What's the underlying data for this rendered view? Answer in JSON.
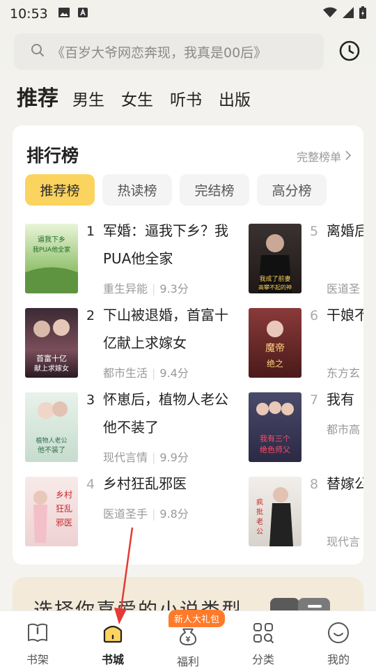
{
  "status_bar": {
    "time": "10:53"
  },
  "search": {
    "placeholder": "《百岁大爷网恋奔现，我真是00后》"
  },
  "channels": [
    "推荐",
    "男生",
    "女生",
    "听书",
    "出版"
  ],
  "ranking": {
    "title": "排行榜",
    "full_list_label": "完整榜单",
    "tabs": [
      "推荐榜",
      "热读榜",
      "完结榜",
      "高分榜"
    ],
    "active_tab": 0,
    "books_left": [
      {
        "rank": "1",
        "title": "军婚：逼我下乡？我PUA他全家",
        "category": "重生异能",
        "score": "9.3分",
        "cover_text": "逼我下乡 我PUA他全家",
        "cover_color": "#7fb35a"
      },
      {
        "rank": "2",
        "title": "下山被退婚，首富十亿献上求嫁女",
        "category": "都市生活",
        "score": "9.4分",
        "cover_text": "首富十亿 献上求嫁女",
        "cover_color": "#5a3a42"
      },
      {
        "rank": "3",
        "title": "怀崽后，植物人老公他不装了",
        "category": "现代言情",
        "score": "9.9分",
        "cover_text": "植物人老公 他不装了",
        "cover_color": "#cfe3d6"
      },
      {
        "rank": "4",
        "title": "乡村狂乱邪医",
        "category": "医道圣手",
        "score": "9.8分",
        "cover_text": "乡村狂乱邪医",
        "cover_color": "#f0d8d8"
      }
    ],
    "books_right": [
      {
        "rank": "5",
        "title": "离婚后妻高攀",
        "category": "医道圣",
        "cover_text": "我成了前妻 高攀不起的神",
        "cover_color": "#2a2220"
      },
      {
        "rank": "6",
        "title": "干娘不知",
        "category": "东方玄",
        "cover_text": "魔帝 绝之",
        "cover_color": "#6a2a2a"
      },
      {
        "rank": "7",
        "title": "我有",
        "category": "都市高",
        "cover_text": "我有三个 绝色师父",
        "cover_color": "#3a3a5a"
      },
      {
        "rank": "8",
        "title": "替嫁公请",
        "category": "现代言",
        "cover_text": "疯批老公 请挂号",
        "cover_color": "#e8e4e0"
      }
    ]
  },
  "genre_banner": {
    "text": "选择你喜爱的小说类型"
  },
  "bottom_nav": {
    "items": [
      "书架",
      "书城",
      "福利",
      "分类",
      "我的"
    ],
    "active": 1,
    "gift_badge": "新人大礼包"
  },
  "colors": {
    "accent": "#fbd35f",
    "badge": "#ff7a2a",
    "annotation_arrow": "#e53935"
  }
}
